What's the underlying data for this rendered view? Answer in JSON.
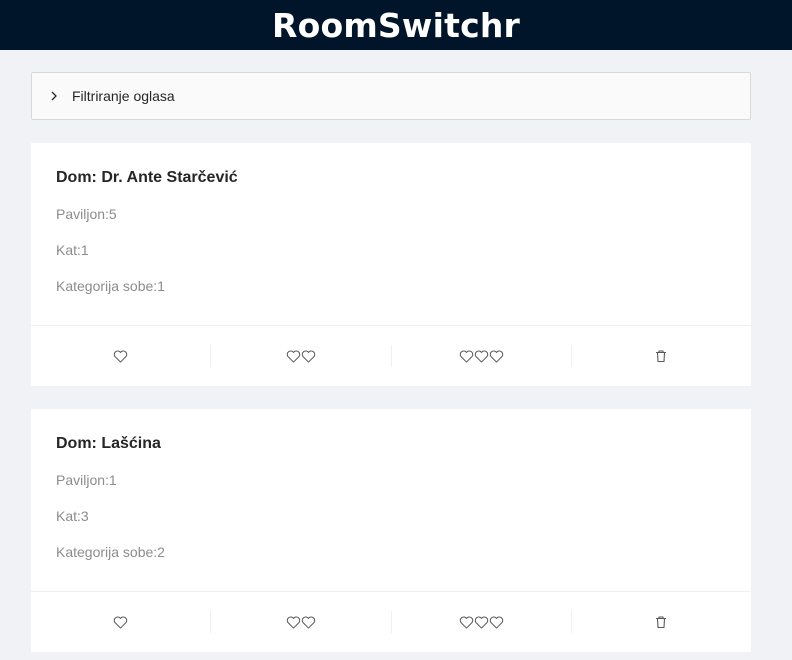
{
  "app": {
    "title": "RoomSwitchr"
  },
  "filter": {
    "label": "Filtriranje oglasa",
    "icon": "chevron-right-icon"
  },
  "listings": [
    {
      "dom_label": "Dom: Dr. Ante Starčević",
      "paviljon": "Paviljon:5",
      "kat": "Kat:1",
      "kategorija": "Kategorija sobe:1"
    },
    {
      "dom_label": "Dom: Lašćina",
      "paviljon": "Paviljon:1",
      "kat": "Kat:3",
      "kategorija": "Kategorija sobe:2"
    }
  ],
  "actions": {
    "like_one": "heart-icon",
    "like_two": "two-hearts-icon",
    "like_three": "three-hearts-icon",
    "delete": "trash-icon"
  },
  "colors": {
    "header_bg": "#001529",
    "page_bg": "#f0f2f5",
    "muted_text": "#8c8c8c",
    "icon": "#595959"
  }
}
